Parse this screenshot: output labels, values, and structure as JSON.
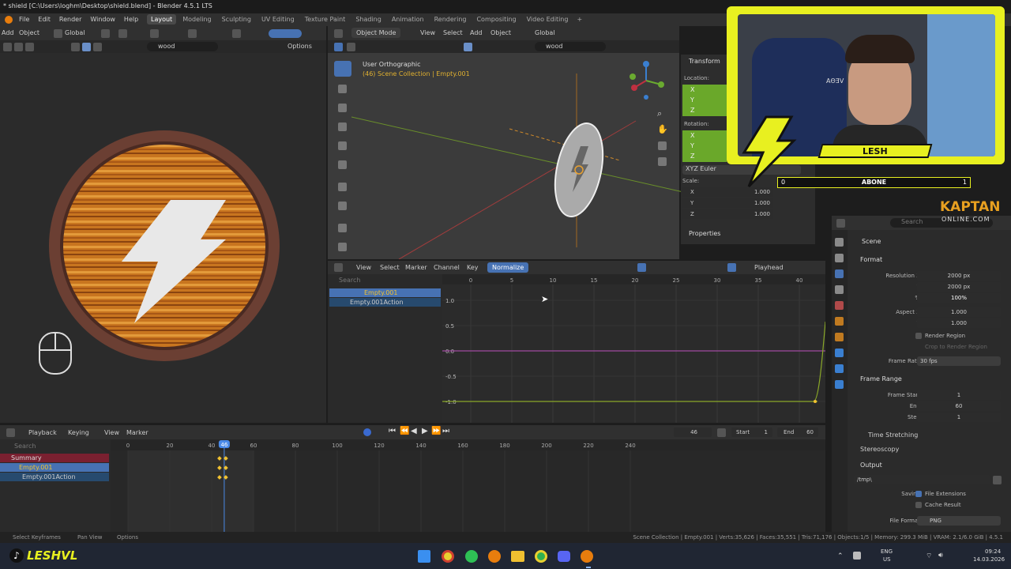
{
  "window_title": "* shield [C:\\Users\\loghm\\Desktop\\shield.blend] - Blender 4.5.1 LTS",
  "menu": [
    "File",
    "Edit",
    "Render",
    "Window",
    "Help"
  ],
  "workspaces": [
    "Layout",
    "Modeling",
    "Sculpting",
    "UV Editing",
    "Texture Paint",
    "Shading",
    "Animation",
    "Rendering",
    "Compositing",
    "Video Editing"
  ],
  "image_editor": {
    "add": "Add",
    "object": "Object",
    "global": "Global",
    "search": "wood",
    "options": "Options"
  },
  "viewport": {
    "mode": "Object Mode",
    "view": "View",
    "select": "Select",
    "add": "Add",
    "object": "Object",
    "global": "Global",
    "search": "wood",
    "view_name": "User Orthographic",
    "collection": "(46) Scene Collection | Empty.001"
  },
  "transform": {
    "title": "Transform",
    "location": "Location:",
    "rotation": "Rotation:",
    "euler": "XYZ Euler",
    "scale": "Scale:",
    "axes": [
      "X",
      "Y",
      "Z"
    ],
    "scale_values": [
      "1.000",
      "1.000",
      "1.000"
    ],
    "properties": "Properties"
  },
  "graph": {
    "view": "View",
    "select": "Select",
    "marker": "Marker",
    "channel": "Channel",
    "key": "Key",
    "normalize": "Normalize",
    "playhead": "Playhead",
    "search": "Search",
    "frame_ticks": [
      "0",
      "5",
      "10",
      "15",
      "20",
      "25",
      "30",
      "35",
      "40"
    ],
    "y_ticks": [
      "1.0",
      "0.5",
      "0.0",
      "-0.5",
      "-1.0"
    ],
    "channels": [
      "Empty.001",
      "Empty.001Action"
    ]
  },
  "timeline": {
    "playback": "Playback",
    "keying": "Keying",
    "view": "View",
    "marker": "Marker",
    "current_frame": "46",
    "start_label": "Start",
    "start": "1",
    "end_label": "End",
    "end": "60",
    "ticks": [
      "0",
      "20",
      "40",
      "60",
      "80",
      "100",
      "120",
      "140",
      "160",
      "180",
      "200",
      "220",
      "240"
    ],
    "playhead": "46",
    "search": "Search",
    "channels": [
      "Summary",
      "Empty.001",
      "Empty.001Action"
    ]
  },
  "properties": {
    "search": "Search",
    "scene": "Scene",
    "format": "Format",
    "res_x_label": "Resolution X",
    "res_x": "2000 px",
    "res_y_label": "Y",
    "res_y": "2000 px",
    "pct_label": "%",
    "pct": "100%",
    "aspect_x_label": "Aspect X",
    "aspect_x": "1.000",
    "aspect_y_label": "Y",
    "aspect_y": "1.000",
    "render_region": "Render Region",
    "crop": "Crop to Render Region",
    "frame_rate_label": "Frame Rate",
    "frame_rate": "30 fps",
    "frame_range": "Frame Range",
    "fstart_label": "Frame Start",
    "fstart": "1",
    "fend_label": "End",
    "fend": "60",
    "step_label": "Step",
    "step": "1",
    "time_stretching": "Time Stretching",
    "stereoscopy": "Stereoscopy",
    "output": "Output",
    "path": "/tmp\\",
    "saving": "Saving",
    "file_ext": "File Extensions",
    "cache": "Cache Result",
    "file_format_label": "File Format",
    "file_format": "PNG"
  },
  "status": {
    "left1": "Select Keyframes",
    "left2": "Pan View",
    "left3": "Options",
    "right": "Scene Collection | Empty.001 | Verts:35,626 | Faces:35,551 | Tris:71,176 | Objects:1/5 | Memory: 299.3 MiB | VRAM: 2.1/6.0 GiB | 4.5.1"
  },
  "stream": {
    "name": "LESH",
    "abone_left": "0",
    "abone": "ABONE",
    "abone_right": "1",
    "brand": "KAPTAN",
    "brand_sub": "ONLINE.COM",
    "handle": "LESHVL",
    "wall_text": "AΘƎV"
  },
  "taskbar": {
    "lang": "ENG",
    "region": "US",
    "time": "09:24",
    "date": "14.03.2026"
  },
  "colors": {
    "accent": "#4772b3",
    "yellow": "#f2e01a",
    "keyframe": "#f2c230"
  }
}
